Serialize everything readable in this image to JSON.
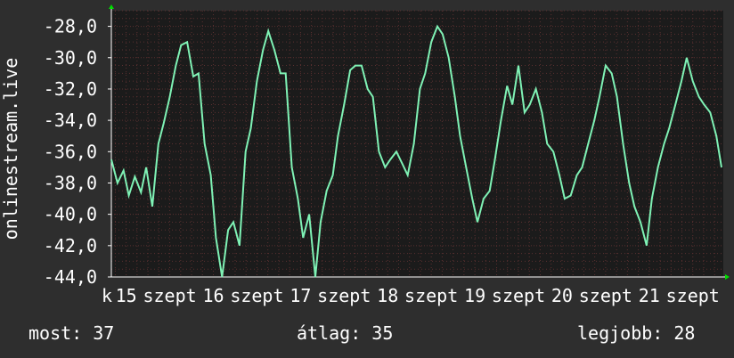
{
  "colors": {
    "background": "#2e2e2e",
    "plot_background": "#1b1b1b",
    "grid": "#5a3030",
    "series": "#7ff2b5",
    "axis_arrow": "#00dd00",
    "text": "#ffffff"
  },
  "footer": {
    "now": "most: 37",
    "avg": "átlag: 35",
    "best": "legjobb: 28"
  },
  "chart_data": {
    "type": "line",
    "ylabel": "onlinestream.live",
    "ylim": [
      -44,
      -27
    ],
    "yticks": [
      -44,
      -42,
      -40,
      -38,
      -36,
      -34,
      -32,
      -30,
      -28
    ],
    "ytick_labels": [
      "-44,0",
      "-42,0",
      "-40,0",
      "-38,0",
      "-36,0",
      "-34,0",
      "-32,0",
      "-30,0",
      "-28,0"
    ],
    "grid": true,
    "xlim": [
      14.83,
      21.85
    ],
    "xticks": [
      14.75,
      15,
      15.5,
      16,
      16.5,
      17,
      17.5,
      18,
      18.5,
      19,
      19.5,
      20,
      20.5,
      21,
      21.5
    ],
    "xtick_labels": [
      "k",
      "15",
      "szept",
      "16",
      "szept",
      "17",
      "szept",
      "18",
      "szept",
      "19",
      "szept",
      "20",
      "szept",
      "21",
      "szept"
    ],
    "series": [
      {
        "x": [
          14.83,
          14.9,
          14.97,
          15.03,
          15.1,
          15.17,
          15.23,
          15.3,
          15.37,
          15.43,
          15.5,
          15.57,
          15.63,
          15.7,
          15.77,
          15.83,
          15.9,
          15.97,
          16.03,
          16.1,
          16.17,
          16.23,
          16.3,
          16.37,
          16.43,
          16.5,
          16.57,
          16.63,
          16.7,
          16.77,
          16.83,
          16.9,
          16.97,
          17.03,
          17.1,
          17.17,
          17.23,
          17.3,
          17.37,
          17.43,
          17.5,
          17.57,
          17.63,
          17.7,
          17.77,
          17.83,
          17.9,
          17.97,
          18.03,
          18.1,
          18.17,
          18.23,
          18.3,
          18.37,
          18.43,
          18.5,
          18.57,
          18.63,
          18.7,
          18.77,
          18.83,
          18.9,
          18.97,
          19.03,
          19.1,
          19.17,
          19.23,
          19.3,
          19.37,
          19.43,
          19.5,
          19.57,
          19.63,
          19.7,
          19.77,
          19.83,
          19.9,
          19.97,
          20.03,
          20.1,
          20.17,
          20.23,
          20.3,
          20.37,
          20.43,
          20.5,
          20.57,
          20.63,
          20.7,
          20.77,
          20.83,
          20.9,
          20.97,
          21.03,
          21.1,
          21.17,
          21.23,
          21.3,
          21.37,
          21.43,
          21.5,
          21.57,
          21.63,
          21.7,
          21.77,
          21.83
        ],
        "y": [
          -36.5,
          -38.0,
          -37.2,
          -38.8,
          -37.6,
          -38.6,
          -37.0,
          -39.5,
          -35.5,
          -34.2,
          -32.5,
          -30.5,
          -29.2,
          -29.0,
          -31.2,
          -31.0,
          -35.5,
          -37.5,
          -41.5,
          -44.0,
          -41.0,
          -40.5,
          -42.0,
          -36.0,
          -34.5,
          -31.5,
          -29.5,
          -28.3,
          -29.5,
          -31.0,
          -31.0,
          -37.0,
          -39.0,
          -41.5,
          -40.0,
          -44.0,
          -40.5,
          -38.5,
          -37.5,
          -35.0,
          -33.0,
          -30.8,
          -30.5,
          -30.5,
          -32.0,
          -32.5,
          -36.0,
          -37.0,
          -36.5,
          -36.0,
          -36.8,
          -37.5,
          -35.5,
          -32.0,
          -31.0,
          -29.0,
          -28.0,
          -28.5,
          -30.0,
          -32.5,
          -35.0,
          -37.0,
          -39.0,
          -40.5,
          -39.0,
          -38.5,
          -36.5,
          -34.0,
          -31.8,
          -33.0,
          -30.5,
          -33.5,
          -33.0,
          -32.0,
          -33.5,
          -35.5,
          -36.0,
          -37.5,
          -39.0,
          -38.8,
          -37.5,
          -37.0,
          -35.5,
          -34.0,
          -32.5,
          -30.5,
          -31.0,
          -32.5,
          -35.5,
          -38.0,
          -39.5,
          -40.5,
          -42.0,
          -39.0,
          -37.0,
          -35.5,
          -34.5,
          -33.0,
          -31.5,
          -30.0,
          -31.5,
          -32.5,
          -33.0,
          -33.5,
          -35.0,
          -37.0
        ]
      }
    ]
  }
}
